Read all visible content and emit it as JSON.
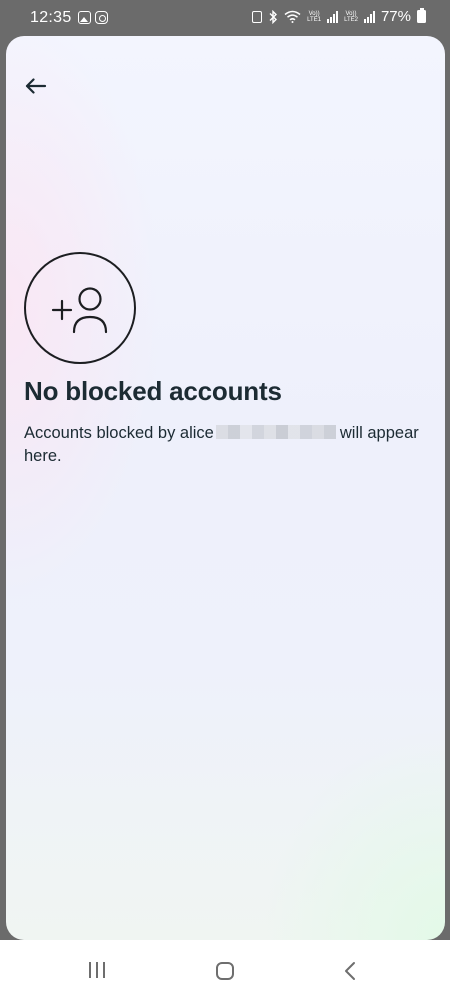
{
  "status_bar": {
    "time": "12:35",
    "battery_percent": "77%",
    "carrier1_top": "Vo))",
    "carrier1_bottom": "LTE1",
    "carrier2_top": "Vo))",
    "carrier2_bottom": "LTE2",
    "left_icons": [
      "gallery-icon",
      "instagram-icon"
    ],
    "right_icons": [
      "battery-saver-icon",
      "bluetooth-icon",
      "wifi-icon",
      "signal-icon",
      "battery-icon"
    ]
  },
  "screen": {
    "back_icon": "back-arrow-icon",
    "empty_icon": "add-person-icon",
    "title": "No blocked accounts",
    "description_prefix": "Accounts blocked by alice",
    "description_suffix": "will appear here."
  },
  "nav_bar": {
    "icons": [
      "recent-apps-icon",
      "home-icon",
      "back-icon"
    ]
  },
  "colors": {
    "text": "#1c2b33",
    "status_bar": "#6b6b6b",
    "nav_bar": "#ffffff",
    "nav_icon": "#6e6e6e"
  }
}
